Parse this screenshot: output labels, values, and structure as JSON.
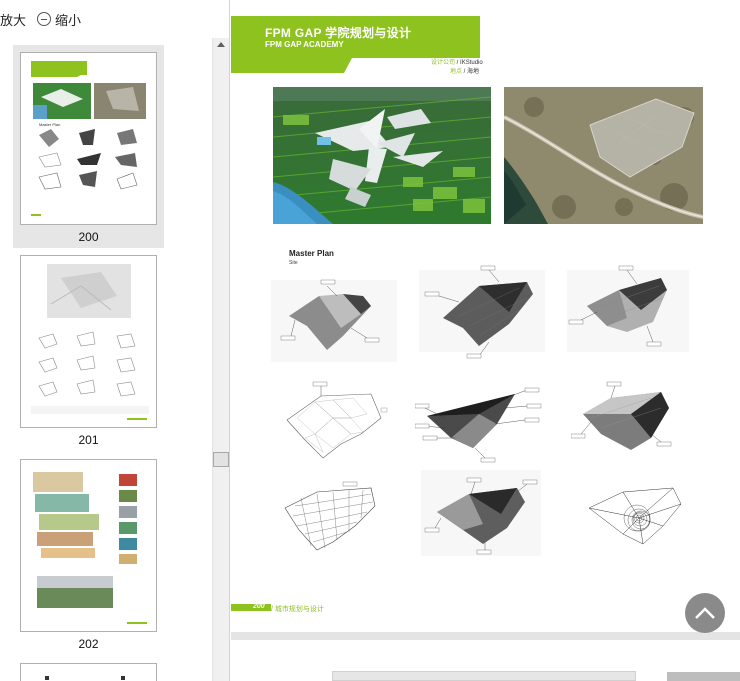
{
  "toolbar": {
    "zoom_in_label": "放大",
    "zoom_out_label": "缩小"
  },
  "thumbnails": [
    {
      "page_number": "200",
      "selected": true
    },
    {
      "page_number": "201",
      "selected": false
    },
    {
      "page_number": "202",
      "selected": false
    }
  ],
  "document": {
    "title": "FPM GAP 学院规划与设计",
    "subtitle": "FPM GAP ACADEMY",
    "designer_key": "设计公司",
    "designer_value": "IKStudio",
    "site_key": "地点",
    "site_value": "海地",
    "masterplan_title": "Master Plan",
    "masterplan_subtitle": "Site",
    "footer_page": "200",
    "footer_label": "城市规划与设计"
  },
  "colors": {
    "accent_green": "#8dc21f",
    "back_to_top_bg": "#8a8a8a"
  },
  "icons": {
    "zoom_out": "minus-circle-icon",
    "back_to_top": "chevron-up-icon"
  }
}
